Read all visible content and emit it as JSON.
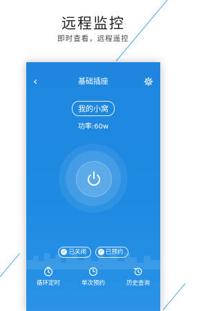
{
  "promo": {
    "title": "远程监控",
    "subtitle": "即时查看，远程遥控"
  },
  "colors": {
    "accent": "#1f8ae1",
    "deco_line": "#4aa8ea"
  },
  "nav": {
    "back_icon": "chevron-left-icon",
    "title": "基础插座",
    "settings_icon": "gear-icon"
  },
  "device": {
    "name": "我的小窝",
    "power_label": "功率:",
    "power_value": "60w"
  },
  "power_button": {
    "icon": "power-icon"
  },
  "status": {
    "closed_label": "已关闭",
    "scheduled_label": "已预约"
  },
  "toolbar": {
    "items": [
      {
        "label": "循环定时",
        "icon": "timer-icon"
      },
      {
        "label": "单次预约",
        "icon": "clock-icon"
      },
      {
        "label": "历史查询",
        "icon": "history-icon"
      }
    ]
  }
}
